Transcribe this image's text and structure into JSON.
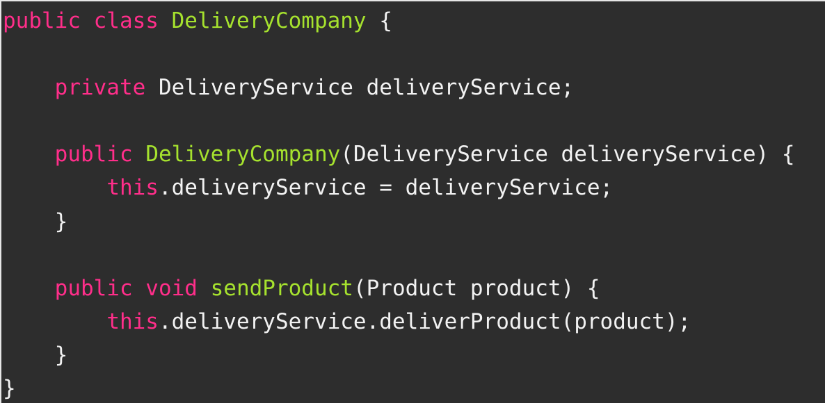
{
  "colors": {
    "background": "#2d2d2d",
    "text": "#f2f2f2",
    "keyword": "#ff2e8a",
    "identifier": "#a6e22e"
  },
  "code": {
    "lines": [
      [
        {
          "text": "public class ",
          "type": "keyword"
        },
        {
          "text": "DeliveryCompany",
          "type": "identifier"
        },
        {
          "text": " {",
          "type": "plain"
        }
      ],
      [],
      [
        {
          "text": "    ",
          "type": "plain"
        },
        {
          "text": "private",
          "type": "keyword"
        },
        {
          "text": " DeliveryService deliveryService;",
          "type": "plain"
        }
      ],
      [],
      [
        {
          "text": "    ",
          "type": "plain"
        },
        {
          "text": "public",
          "type": "keyword"
        },
        {
          "text": " ",
          "type": "plain"
        },
        {
          "text": "DeliveryCompany",
          "type": "identifier"
        },
        {
          "text": "(DeliveryService deliveryService) {",
          "type": "plain"
        }
      ],
      [
        {
          "text": "        ",
          "type": "plain"
        },
        {
          "text": "this",
          "type": "keyword"
        },
        {
          "text": ".deliveryService = deliveryService;",
          "type": "plain"
        }
      ],
      [
        {
          "text": "    }",
          "type": "plain"
        }
      ],
      [],
      [
        {
          "text": "    ",
          "type": "plain"
        },
        {
          "text": "public void",
          "type": "keyword"
        },
        {
          "text": " ",
          "type": "plain"
        },
        {
          "text": "sendProduct",
          "type": "identifier"
        },
        {
          "text": "(Product product) {",
          "type": "plain"
        }
      ],
      [
        {
          "text": "        ",
          "type": "plain"
        },
        {
          "text": "this",
          "type": "keyword"
        },
        {
          "text": ".deliveryService.deliverProduct(product);",
          "type": "plain"
        }
      ],
      [
        {
          "text": "    }",
          "type": "plain"
        }
      ],
      [
        {
          "text": "}",
          "type": "plain"
        }
      ]
    ]
  }
}
